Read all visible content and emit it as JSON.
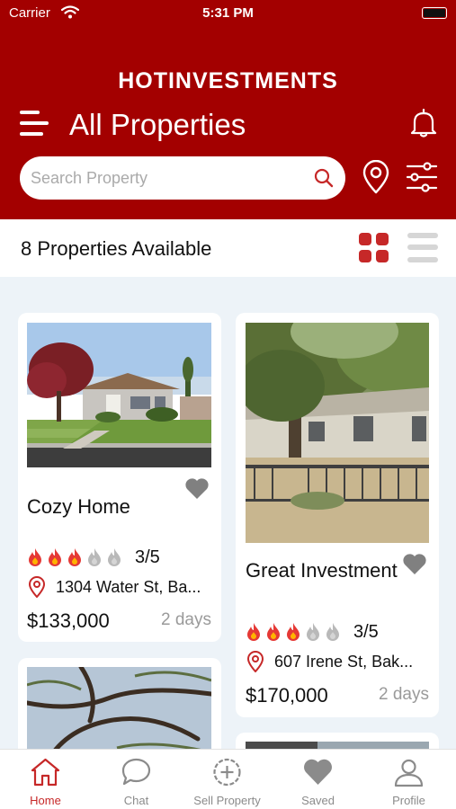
{
  "status_bar": {
    "carrier": "Carrier",
    "time": "5:31 PM"
  },
  "header": {
    "brand": "HOTINVESTMENTS",
    "title": "All Properties",
    "search": {
      "placeholder": "Search Property",
      "value": ""
    }
  },
  "listing": {
    "count_label": "8 Properties Available",
    "view_mode": "grid"
  },
  "properties": [
    {
      "title": "Cozy Home",
      "rating_value": 3,
      "rating_max": 5,
      "rating_text": "3/5",
      "address": "1304 Water St, Ba...",
      "price": "$133,000",
      "age": "2 days"
    },
    {
      "title": "Great Investment",
      "rating_value": 3,
      "rating_max": 5,
      "rating_text": "3/5",
      "address": "607 Irene St, Bak...",
      "price": "$170,000",
      "age": "2 days"
    }
  ],
  "tabbar": {
    "tabs": [
      {
        "label": "Home",
        "icon": "home-icon",
        "active": true
      },
      {
        "label": "Chat",
        "icon": "chat-bubble-icon",
        "active": false
      },
      {
        "label": "Sell Property",
        "icon": "add-circle-icon",
        "active": false
      },
      {
        "label": "Saved",
        "icon": "heart-icon",
        "active": false
      },
      {
        "label": "Profile",
        "icon": "person-icon",
        "active": false
      }
    ]
  },
  "colors": {
    "brand": "#a30000",
    "accent": "#c62828",
    "muted": "#8b8b8b",
    "background": "#edf3f8"
  }
}
